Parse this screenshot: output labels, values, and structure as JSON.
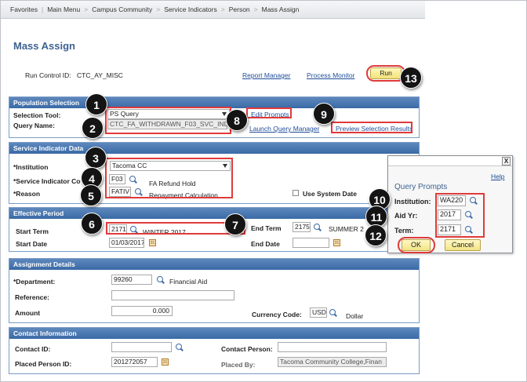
{
  "breadcrumb": [
    "Favorites",
    "Main Menu",
    "Campus Community",
    "Service Indicators",
    "Person",
    "Mass Assign"
  ],
  "page_title": "Mass Assign",
  "run_control": {
    "label": "Run Control ID:",
    "value": "CTC_AY_MISC",
    "report_manager": "Report Manager",
    "process_monitor": "Process Monitor",
    "run_button": "Run"
  },
  "population": {
    "header": "Population Selection",
    "tool_label": "Selection Tool:",
    "tool_value": "PS Query",
    "query_label": "Query Name:",
    "query_value": "CTC_FA_WITHDRAWN_F03_SVC_IND",
    "edit_prompts": "Edit Prompts",
    "launch_qm": "Launch Query Manager",
    "preview": "Preview Selection Results"
  },
  "service_indicator": {
    "header": "Service Indicator Data",
    "institution_label": "*Institution",
    "institution_value": "Tacoma CC",
    "code_label": "*Service Indicator Co",
    "code_value": "F03",
    "code_desc": "FA Refund Hold",
    "reason_label": "*Reason",
    "reason_value": "FATIV",
    "reason_desc": "Repayment Calculation",
    "use_system_date": "Use System Date"
  },
  "effective": {
    "header": "Effective Period",
    "start_term_label": "Start Term",
    "start_term_value": "2171",
    "start_term_desc": "WINTER 2017",
    "end_term_label": "End Term",
    "end_term_value": "2175",
    "end_term_desc": "SUMMER 2",
    "start_date_label": "Start Date",
    "start_date_value": "01/03/2017",
    "end_date_label": "End Date",
    "end_date_value": ""
  },
  "assignment": {
    "header": "Assignment Details",
    "department_label": "*Department:",
    "department_value": "99260",
    "department_desc": "Financial Aid",
    "reference_label": "Reference:",
    "reference_value": "",
    "amount_label": "Amount",
    "amount_value": "0.000",
    "currency_label": "Currency Code:",
    "currency_value": "USD",
    "currency_desc": "Dollar"
  },
  "contact": {
    "header": "Contact Information",
    "contact_id_label": "Contact ID:",
    "contact_id_value": "",
    "contact_person_label": "Contact Person:",
    "contact_person_value": "",
    "placed_person_label": "Placed Person ID:",
    "placed_person_value": "201272057",
    "placed_by_label": "Placed By:",
    "placed_by_value": "Tacoma Community College,Finan"
  },
  "query_prompts": {
    "close": "X",
    "help": "Help",
    "title": "Query Prompts",
    "institution_label": "Institution:",
    "institution_value": "WA220",
    "aid_yr_label": "Aid Yr:",
    "aid_yr_value": "2017",
    "term_label": "Term:",
    "term_value": "2171",
    "ok": "OK",
    "cancel": "Cancel"
  },
  "badges": [
    "1",
    "2",
    "3",
    "4",
    "5",
    "6",
    "7",
    "8",
    "9",
    "10",
    "11",
    "12",
    "13"
  ],
  "colors": {
    "section_header": "#3a6aa6",
    "title_blue": "#3e6291",
    "callout_red": "#e03a3a",
    "badge_black": "#141414",
    "button_yellow": "#f3e27a"
  }
}
